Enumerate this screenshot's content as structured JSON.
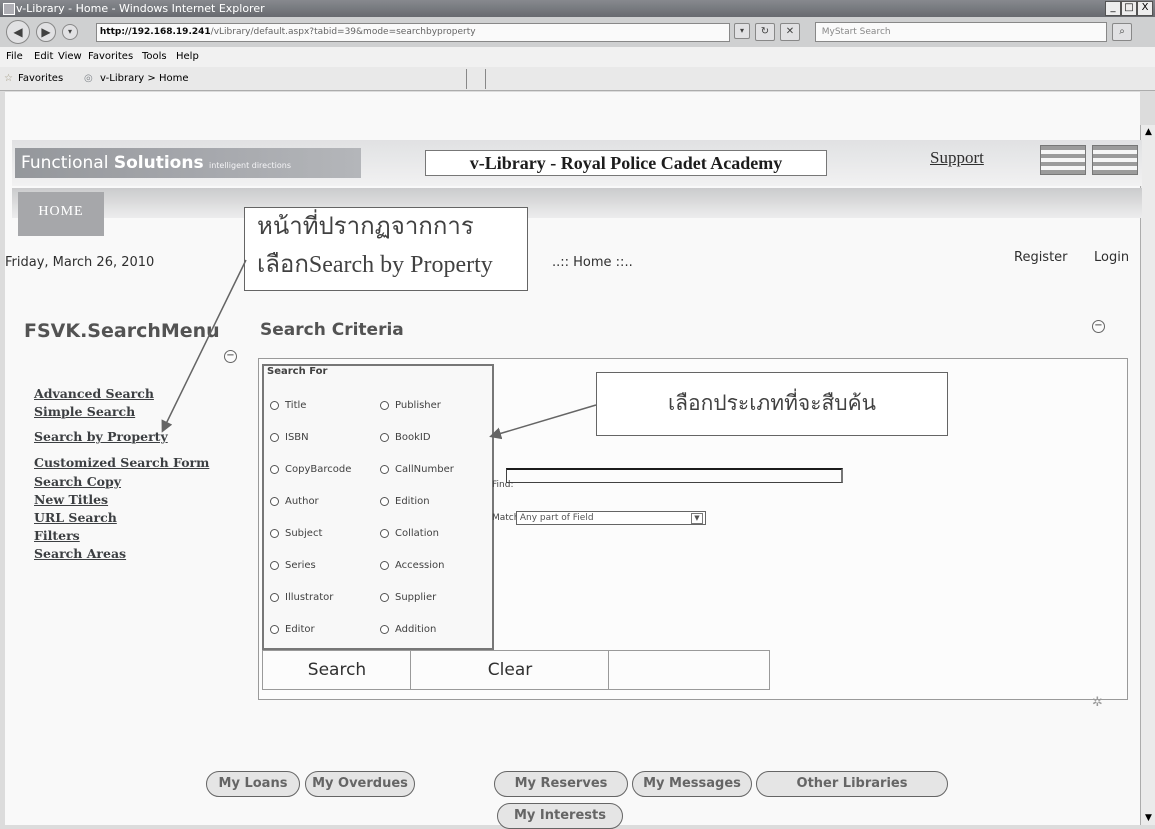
{
  "window": {
    "title": "v-Library - Home - Windows Internet Explorer",
    "url_host": "http://192.168.19.241",
    "url_path": "/vLibrary/default.aspx?tabid=39&mode=searchbyproperty",
    "search_placeholder": "MyStart Search",
    "controls": [
      "_",
      "□",
      "X"
    ]
  },
  "menubar": [
    "File",
    "Edit",
    "View",
    "Favorites",
    "Tools",
    "Help"
  ],
  "favorites": {
    "label": "Favorites",
    "tab": "v-Library > Home"
  },
  "header": {
    "logo_main": "Functional",
    "logo_bold": "Solutions",
    "logo_tag": "intelligent directions",
    "site_title": "v-Library - Royal Police Cadet Academy",
    "support": "Support"
  },
  "nav": {
    "home": "HOME"
  },
  "date": "Friday, March 26, 2010",
  "breadcrumb": "..:: Home ::..",
  "auth": {
    "register": "Register",
    "login": "Login"
  },
  "callout_page": {
    "line1": "หน้าที่ปรากฏจากการ",
    "line2": "เลือกSearch by Property"
  },
  "callout_type": "เลือกประเภทที่จะสืบค้น",
  "sidebar": {
    "title": "FSVK.SearchMenu",
    "items": [
      "Advanced Search",
      "Simple Search",
      "Search by Property",
      "Customized Search Form",
      "Search Copy",
      "New Titles",
      "URL Search",
      "Filters",
      "Search Areas"
    ]
  },
  "criteria": {
    "title": "Search Criteria",
    "search_for": "Search For",
    "options_left": [
      "Title",
      "ISBN",
      "CopyBarcode",
      "Author",
      "Subject",
      "Series",
      "Illustrator",
      "Editor"
    ],
    "options_right": [
      "Publisher",
      "BookID",
      "CallNumber",
      "Edition",
      "Collation",
      "Accession",
      "Supplier",
      "Addition"
    ],
    "find_label": "Find:",
    "find_value": "",
    "match_label": "Match:",
    "match_value": "Any part of Field",
    "search_button": "Search",
    "clear_button": "Clear"
  },
  "footer_tabs": [
    "My Loans",
    "My Overdues",
    "My Reserves",
    "My Messages",
    "Other Libraries",
    "My Interests"
  ]
}
